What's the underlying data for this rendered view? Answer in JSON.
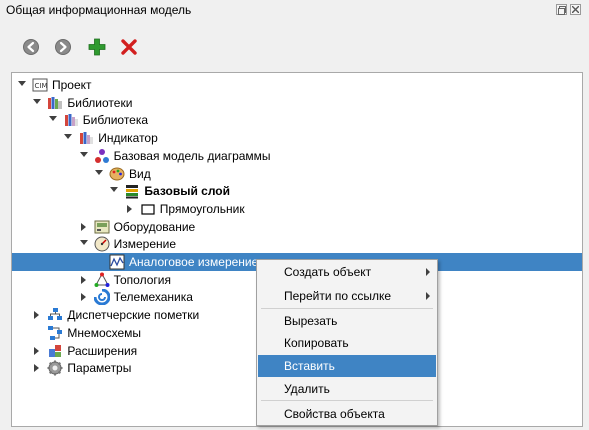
{
  "window": {
    "title": "Общая информационная модель"
  },
  "toolbar": [
    {
      "name": "back-button",
      "icon": "arrow-left-icon"
    },
    {
      "name": "forward-button",
      "icon": "arrow-right-icon"
    },
    {
      "name": "add-button",
      "icon": "plus-icon"
    },
    {
      "name": "delete-button",
      "icon": "delete-x-icon"
    }
  ],
  "tree": [
    {
      "label": "Проект",
      "level": 0,
      "expand": "down",
      "icon": "cim-icon"
    },
    {
      "label": "Библиотеки",
      "level": 1,
      "expand": "down",
      "icon": "libraries-icon"
    },
    {
      "label": "Библиотека",
      "level": 2,
      "expand": "down",
      "icon": "library-icon"
    },
    {
      "label": "Индикатор",
      "level": 3,
      "expand": "down",
      "icon": "library-icon"
    },
    {
      "label": "Базовая модель диаграммы",
      "level": 4,
      "expand": "down",
      "icon": "diagram-model-icon"
    },
    {
      "label": "Вид",
      "level": 5,
      "expand": "down",
      "icon": "palette-icon"
    },
    {
      "label": "Базовый слой",
      "level": 6,
      "expand": "down",
      "icon": "layers-icon",
      "bold": true
    },
    {
      "label": "Прямоугольник",
      "level": 7,
      "expand": "right",
      "icon": "rectangle-icon"
    },
    {
      "label": "Оборудование",
      "level": 4,
      "expand": "right",
      "icon": "equipment-icon"
    },
    {
      "label": "Измерение",
      "level": 4,
      "expand": "down",
      "icon": "gauge-icon"
    },
    {
      "label": "Аналоговое измерение",
      "level": 5,
      "expand": "none",
      "icon": "analog-measure-icon",
      "selected": true
    },
    {
      "label": "Топология",
      "level": 4,
      "expand": "right",
      "icon": "topology-icon"
    },
    {
      "label": "Телемеханика",
      "level": 4,
      "expand": "right",
      "icon": "telemechanics-icon"
    },
    {
      "label": "Диспетчерские пометки",
      "level": 1,
      "expand": "right",
      "icon": "dispatch-marks-icon"
    },
    {
      "label": "Мнемосхемы",
      "level": 1,
      "expand": "none",
      "icon": "mnemonic-icon"
    },
    {
      "label": "Расширения",
      "level": 1,
      "expand": "right",
      "icon": "extensions-icon"
    },
    {
      "label": "Параметры",
      "level": 1,
      "expand": "right",
      "icon": "gear-icon"
    }
  ],
  "context_menu": {
    "items": [
      {
        "label": "Создать объект",
        "submenu": true
      },
      {
        "label": "Перейти по ссылке",
        "submenu": true
      },
      {
        "label": "Вырезать"
      },
      {
        "label": "Копировать"
      },
      {
        "label": "Вставить",
        "highlighted": true
      },
      {
        "label": "Удалить"
      },
      {
        "label": "Свойства объекта"
      }
    ]
  },
  "colors": {
    "selection": "#3f84c4",
    "background": "#f0f0f0"
  }
}
